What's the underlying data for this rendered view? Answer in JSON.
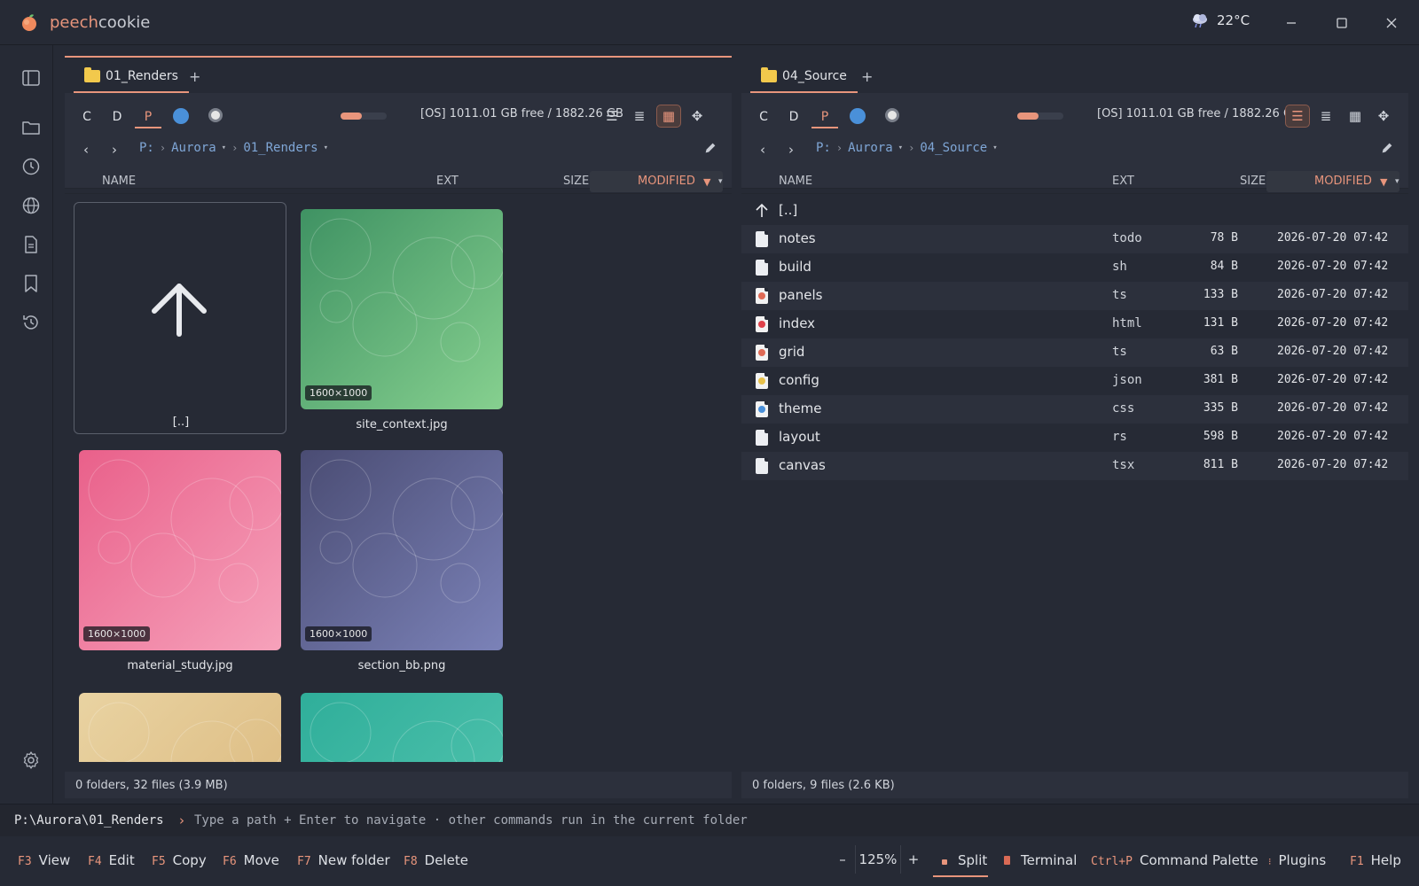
{
  "app": {
    "name_accent": "peech",
    "name_rest": "cookie",
    "weather": "22°C"
  },
  "left": {
    "tab": "01_Renders",
    "drives": [
      "C",
      "D",
      "P"
    ],
    "free": "[OS] 1011.01 GB free / 1882.26 GB",
    "usage": 0.46,
    "crumbs": {
      "root": "P:",
      "a": "Aurora",
      "b": "01_Renders"
    },
    "cols": {
      "name": "NAME",
      "ext": "EXT",
      "size": "SIZE",
      "modified": "MODIFIED"
    },
    "up_label": "[..]",
    "thumbs": [
      {
        "name": "site_context.jpg",
        "dims": "1600×1000",
        "c1": "#3f9263",
        "c2": "#86d08f"
      },
      {
        "name": "material_study.jpg",
        "dims": "1600×1000",
        "c1": "#e9608a",
        "c2": "#f6a2bb"
      },
      {
        "name": "section_bb.png",
        "dims": "1600×1000",
        "c1": "#4a4c73",
        "c2": "#7b82b8"
      },
      {
        "name": "",
        "dims": "",
        "c1": "#e9d3a2",
        "c2": "#d9b579"
      },
      {
        "name": "",
        "dims": "",
        "c1": "#2fae9a",
        "c2": "#57c7b1"
      }
    ],
    "status": "0 folders, 32 files (3.9 MB)"
  },
  "right": {
    "tab": "04_Source",
    "drives": [
      "C",
      "D",
      "P"
    ],
    "free": "[OS] 1011.01 GB free / 1882.26 GB",
    "usage": 0.46,
    "crumbs": {
      "root": "P:",
      "a": "Aurora",
      "b": "04_Source"
    },
    "cols": {
      "name": "NAME",
      "ext": "EXT",
      "size": "SIZE",
      "modified": "MODIFIED"
    },
    "up_label": "[..]",
    "files": [
      {
        "name": "notes",
        "ext": "todo",
        "size": "78 B",
        "modified": "2026-07-20 07:42",
        "icon": "file",
        "color": "#eceef2"
      },
      {
        "name": "build",
        "ext": "sh",
        "size": "84 B",
        "modified": "2026-07-20 07:42",
        "icon": "file",
        "color": "#eceef2"
      },
      {
        "name": "panels",
        "ext": "ts",
        "size": "133 B",
        "modified": "2026-07-20 07:42",
        "icon": "play-file",
        "color": "#e06a55"
      },
      {
        "name": "index",
        "ext": "html",
        "size": "131 B",
        "modified": "2026-07-20 07:42",
        "icon": "html-file",
        "color": "#e0414a"
      },
      {
        "name": "grid",
        "ext": "ts",
        "size": "63 B",
        "modified": "2026-07-20 07:42",
        "icon": "play-file",
        "color": "#e06a55"
      },
      {
        "name": "config",
        "ext": "json",
        "size": "381 B",
        "modified": "2026-07-20 07:42",
        "icon": "json-file",
        "color": "#e8c14a"
      },
      {
        "name": "theme",
        "ext": "css",
        "size": "335 B",
        "modified": "2026-07-20 07:42",
        "icon": "css-file",
        "color": "#4a90d9"
      },
      {
        "name": "layout",
        "ext": "rs",
        "size": "598 B",
        "modified": "2026-07-20 07:42",
        "icon": "file",
        "color": "#eceef2"
      },
      {
        "name": "canvas",
        "ext": "tsx",
        "size": "811 B",
        "modified": "2026-07-20 07:42",
        "icon": "file",
        "color": "#eceef2"
      }
    ],
    "status": "0 folders, 9 files (2.6 KB)"
  },
  "cmd": {
    "path": "P:\\Aurora\\01_Renders",
    "hint": "Type a path + Enter to navigate · other commands run in the current folder"
  },
  "bottom": {
    "f3": {
      "k": "F3",
      "label": "View"
    },
    "f4": {
      "k": "F4",
      "label": "Edit"
    },
    "f5": {
      "k": "F5",
      "label": "Copy"
    },
    "f6": {
      "k": "F6",
      "label": "Move"
    },
    "f7": {
      "k": "F7",
      "label": "New folder"
    },
    "f8": {
      "k": "F8",
      "label": "Delete"
    },
    "zoom_minus": "–",
    "zoom": "125%",
    "zoom_plus": "+",
    "split": "Split",
    "terminal": "Terminal",
    "palette": {
      "k": "Ctrl+P",
      "label": "Command Palette"
    },
    "plugins": "Plugins",
    "help": {
      "k": "F1",
      "label": "Help"
    }
  },
  "colors": {
    "accent": "#e8957c",
    "bg": "#262a35",
    "panel": "#2c303c",
    "link": "#7fa6d6"
  }
}
